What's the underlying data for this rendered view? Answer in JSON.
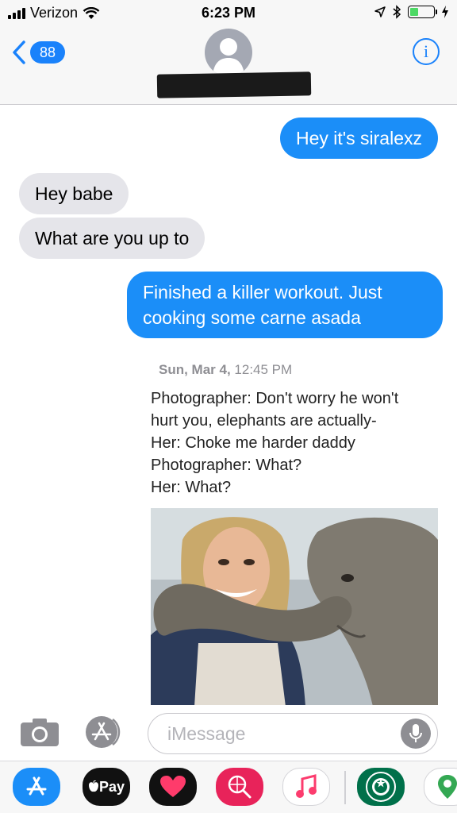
{
  "status_bar": {
    "carrier": "Verizon",
    "time": "6:23 PM",
    "battery_level": 0.35
  },
  "nav": {
    "back_count": "88",
    "info_label": "i"
  },
  "messages": [
    {
      "direction": "outgoing",
      "text": "Hey it's siralexz"
    },
    {
      "direction": "incoming",
      "text": "Hey babe"
    },
    {
      "direction": "incoming",
      "text": "What are you up to"
    },
    {
      "direction": "outgoing",
      "text": "Finished a killer workout. Just cooking some carne asada"
    }
  ],
  "timestamp": {
    "date": "Sun, Mar 4,",
    "time": "12:45 PM"
  },
  "meme": {
    "lines": [
      "Photographer: Don't worry he won't",
      "hurt you, elephants are actually-",
      "Her: Choke me harder daddy",
      "Photographer: What?",
      "Her: What?"
    ]
  },
  "input": {
    "placeholder": "iMessage"
  },
  "app_drawer": {
    "apple_pay_label": "Pay"
  },
  "colors": {
    "imessage_blue": "#1b8ef8",
    "incoming_gray": "#e5e5ea",
    "accent": "#1a82fb"
  }
}
